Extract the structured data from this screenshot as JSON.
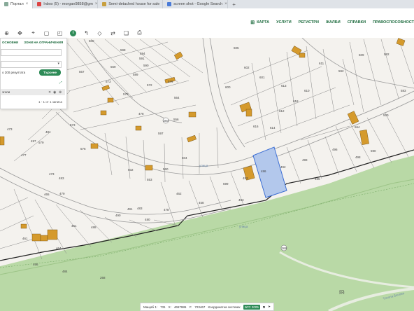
{
  "browser": {
    "tabs": [
      {
        "label": "Портал",
        "active": true
      },
      {
        "label": "Inbox (5) - morgan9858@gm",
        "active": false
      },
      {
        "label": "Semi-detached house for sale",
        "active": false
      },
      {
        "label": "screen shot - Google Search",
        "active": false
      }
    ],
    "new_tab": "+"
  },
  "menu": {
    "items": [
      "КАРТА",
      "УСЛУГИ",
      "РЕГИСТРИ",
      "ЖАЛБИ",
      "СПРАВКИ",
      "ПРАВОСПОСОБНОСТ"
    ]
  },
  "toolbar": {
    "icons": [
      "zoom-icon",
      "pan-icon",
      "location-icon",
      "select-rectangle-icon",
      "select-area-icon",
      "info-icon",
      "measure-icon",
      "polygon-icon",
      "share-icon",
      "layers-icon",
      "print-icon"
    ]
  },
  "panel": {
    "tab_objects": "ОСНОВНИ",
    "tab_zones": "ЗОНИ НА ОГРАНИЧЕНИЯ",
    "limit_text": "о 200 резултата",
    "search_button": "Търсене",
    "result_label": "зголи",
    "result_count": "1 - 1 от 1 записа"
  },
  "status": {
    "scale_label": "Мащаб 1:",
    "scale_value": "731",
    "x_label": "X:",
    "x_value": "4657986",
    "y_label": "Y:",
    "y_value": "723467",
    "crs_label": "Координатна система:",
    "crs_value": "БГС 2005"
  },
  "map": {
    "highlight_color": "#b3c8ec",
    "plot_numbers": [
      "600",
      "598",
      "594",
      "567",
      "569",
      "590",
      "591",
      "589",
      "573",
      "579",
      "572",
      "579",
      "473",
      "477",
      "579",
      "497",
      "576",
      "573",
      "484",
      "478",
      "597",
      "502",
      "556",
      "560",
      "604",
      "564",
      "483",
      "553",
      "491",
      "605",
      "602",
      "601",
      "600",
      "613",
      "612",
      "616",
      "614",
      "618",
      "610",
      "611",
      "592",
      "609",
      "582",
      "583",
      "590",
      "520",
      "564",
      "496",
      "498",
      "499",
      "492",
      "485",
      "486",
      "493",
      "493",
      "599",
      "458",
      "462",
      "478",
      "480",
      "483",
      "490",
      "488",
      "461",
      "464",
      "466",
      "461",
      "465",
      "473",
      "479",
      "484",
      "268",
      "271",
      "272"
    ],
    "street_labels": [
      "улица",
      "улица",
      "Топола Бичова"
    ],
    "street_badges": [
      "170",
      "260",
      "269"
    ]
  }
}
